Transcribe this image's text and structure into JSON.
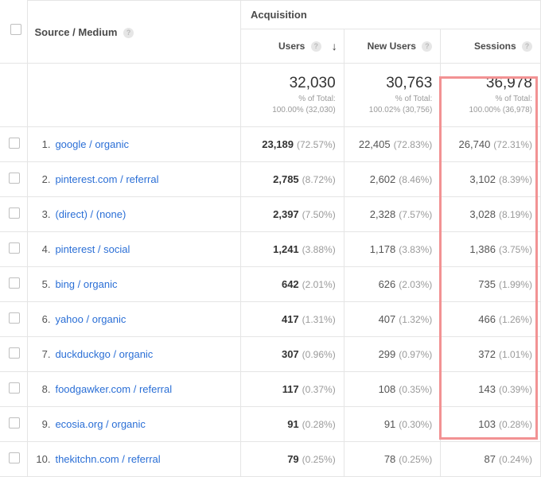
{
  "headers": {
    "source_medium": "Source / Medium",
    "acquisition": "Acquisition",
    "users": "Users",
    "new_users": "New Users",
    "sessions": "Sessions"
  },
  "totals": {
    "users": {
      "value": "32,030",
      "pct_label": "% of Total:",
      "pct": "100.00% (32,030)"
    },
    "new_users": {
      "value": "30,763",
      "pct_label": "% of Total:",
      "pct": "100.02% (30,756)"
    },
    "sessions": {
      "value": "36,978",
      "pct_label": "% of Total:",
      "pct": "100.00% (36,978)"
    }
  },
  "rows": [
    {
      "n": "1.",
      "source": "google / organic",
      "users": "23,189",
      "users_pct": "(72.57%)",
      "new": "22,405",
      "new_pct": "(72.83%)",
      "sess": "26,740",
      "sess_pct": "(72.31%)"
    },
    {
      "n": "2.",
      "source": "pinterest.com / referral",
      "users": "2,785",
      "users_pct": "(8.72%)",
      "new": "2,602",
      "new_pct": "(8.46%)",
      "sess": "3,102",
      "sess_pct": "(8.39%)"
    },
    {
      "n": "3.",
      "source": "(direct) / (none)",
      "users": "2,397",
      "users_pct": "(7.50%)",
      "new": "2,328",
      "new_pct": "(7.57%)",
      "sess": "3,028",
      "sess_pct": "(8.19%)"
    },
    {
      "n": "4.",
      "source": "pinterest / social",
      "users": "1,241",
      "users_pct": "(3.88%)",
      "new": "1,178",
      "new_pct": "(3.83%)",
      "sess": "1,386",
      "sess_pct": "(3.75%)"
    },
    {
      "n": "5.",
      "source": "bing / organic",
      "users": "642",
      "users_pct": "(2.01%)",
      "new": "626",
      "new_pct": "(2.03%)",
      "sess": "735",
      "sess_pct": "(1.99%)"
    },
    {
      "n": "6.",
      "source": "yahoo / organic",
      "users": "417",
      "users_pct": "(1.31%)",
      "new": "407",
      "new_pct": "(1.32%)",
      "sess": "466",
      "sess_pct": "(1.26%)"
    },
    {
      "n": "7.",
      "source": "duckduckgo / organic",
      "users": "307",
      "users_pct": "(0.96%)",
      "new": "299",
      "new_pct": "(0.97%)",
      "sess": "372",
      "sess_pct": "(1.01%)"
    },
    {
      "n": "8.",
      "source": "foodgawker.com / referral",
      "users": "117",
      "users_pct": "(0.37%)",
      "new": "108",
      "new_pct": "(0.35%)",
      "sess": "143",
      "sess_pct": "(0.39%)"
    },
    {
      "n": "9.",
      "source": "ecosia.org / organic",
      "users": "91",
      "users_pct": "(0.28%)",
      "new": "91",
      "new_pct": "(0.30%)",
      "sess": "103",
      "sess_pct": "(0.28%)"
    },
    {
      "n": "10.",
      "source": "thekitchn.com / referral",
      "users": "79",
      "users_pct": "(0.25%)",
      "new": "78",
      "new_pct": "(0.25%)",
      "sess": "87",
      "sess_pct": "(0.24%)"
    }
  ]
}
